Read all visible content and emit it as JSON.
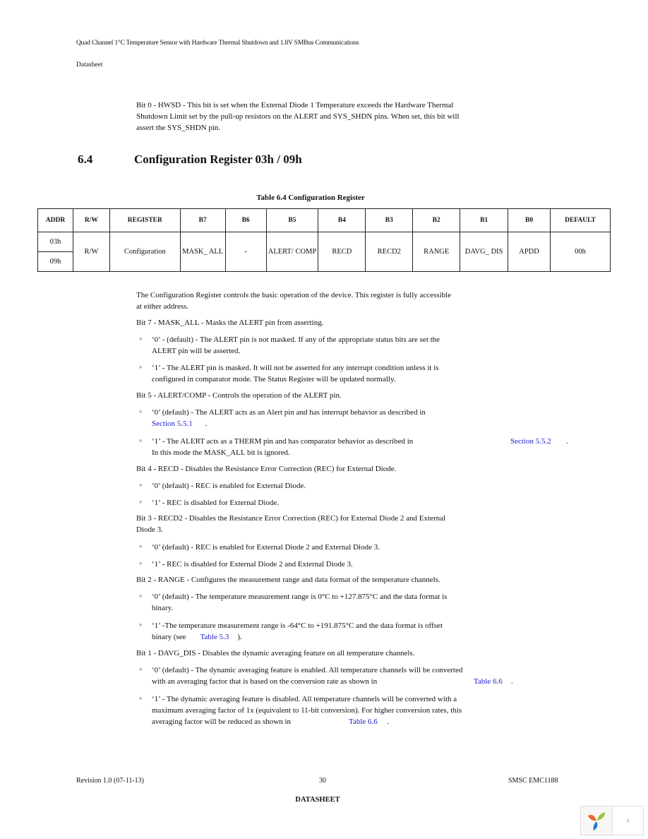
{
  "header": {
    "title": "Quad Channel 1°C Temperature Sensor with Hardware Thermal Shutdown and 1.8V SMBus Communications",
    "subtitle": "Datasheet"
  },
  "intro": {
    "bit0_line1": "Bit 0 - HWSD - This bit is set when the External Diode 1 Temperature exceeds the Hardware Thermal",
    "bit0_line2": "Shutdown Limit set by the pull-up resistors on the ALERT and SYS_SHDN pins. When set, this bit will",
    "bit0_line3": "assert the SYS_SHDN pin."
  },
  "section": {
    "number": "6.4",
    "title": "Configuration Register 03h / 09h"
  },
  "table": {
    "caption": "Table 6.4  Configuration Register",
    "headers": [
      "ADDR",
      "R/W",
      "REGISTER",
      "B7",
      "B6",
      "B5",
      "B4",
      "B3",
      "B2",
      "B1",
      "B0",
      "DEFAULT"
    ],
    "addr": [
      "03h",
      "09h"
    ],
    "rw": "R/W",
    "register": "Configuration",
    "bits": [
      "MASK_ ALL",
      "-",
      "ALERT/ COMP",
      "RECD",
      "RECD2",
      "RANGE",
      "DAVG_ DIS",
      "APDD"
    ],
    "default": "00h"
  },
  "body": {
    "desc_line1": "The Configuration Register controls the basic operation of the device. This register is fully accessible",
    "desc_line2": "at either address.",
    "bit7": {
      "title": "Bit 7 - MASK_ALL - Masks the ALERT pin from asserting.",
      "opt0_l1": "‘0’ - (default) - The ALERT  pin is not masked. If any of the appropriate status bits are set the",
      "opt0_l2": "ALERT  pin will be asserted.",
      "opt1_l1": "‘1’ - The ALERT pin is masked. It will not be asserted for any interrupt condition unless it is",
      "opt1_l2": "configured in comparator mode. The Status Register will be updated normally."
    },
    "bit5": {
      "title": "Bit 5 - ALERT/COMP - Controls the operation of the ALERT  pin.",
      "opt0_l1": "‘0’ (default) - The ALERT  acts as an Alert pin and has interrupt behavior as described in",
      "opt0_link": "Section 5.5.1",
      "opt1_l1": "‘1’ - The ALERT  acts as a THERM pin and has comparator behavior as described in",
      "opt1_link": "Section 5.5.2",
      "opt1_l2": "In this mode the MASK_ALL bit is ignored."
    },
    "bit4": {
      "title": "Bit 4 - RECD - Disables the Resistance Error Correction (REC) for External Diode.",
      "opt0": "‘0’ (default) - REC is enabled for External Diode.",
      "opt1": "‘1’ - REC is disabled for External Diode."
    },
    "bit3": {
      "title_l1": "Bit 3 - RECD2 - Disables the Resistance Error Correction (REC) for External Diode 2 and External",
      "title_l2": "Diode 3.",
      "opt0": "‘0’ (default) - REC is enabled for External Diode 2 and External Diode 3.",
      "opt1": "‘1’ - REC is disabled for External Diode 2 and External Diode 3."
    },
    "bit2": {
      "title": "Bit 2 - RANGE - Configures the measurement range and data format of the temperature channels.",
      "opt0_l1": "‘0’ (default) - The temperature measurement range is 0°C to +127.875°C and the data format is",
      "opt0_l2": "binary.",
      "opt1_l1": "‘1’ -The temperature measurement range is -64°C to +191.875°C and the data format is offset",
      "opt1_l2_pre": "binary (see",
      "opt1_link": "Table 5.3",
      "opt1_l2_post": ")."
    },
    "bit1": {
      "title": "Bit 1 - DAVG_DIS - Disables the dynamic averaging feature on all temperature channels.",
      "opt0_l1": "‘0’ (default) - The dynamic averaging feature is enabled. All temperature channels will be converted",
      "opt0_l2": "with an averaging factor that is based on the conversion rate as shown in",
      "opt0_link": "Table 6.6",
      "opt1_l1": "‘1’ - The dynamic averaging feature is disabled. All temperature channels will be converted with a",
      "opt1_l2": "maximum averaging factor of 1x (equivalent to 11-bit conversion). For higher conversion rates, this",
      "opt1_l3": "averaging factor will be reduced as shown in",
      "opt1_link": "Table 6.6"
    }
  },
  "footer": {
    "revision": "Revision 1.0 (07-11-13)",
    "page": "30",
    "part": "SMSC EMC1188",
    "label": "DATASHEET"
  },
  "viewer": {
    "next_glyph": "›"
  }
}
